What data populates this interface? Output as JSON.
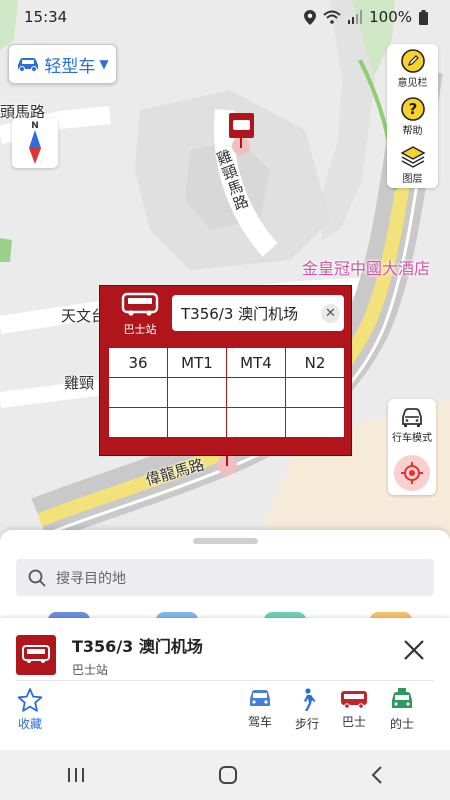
{
  "status": {
    "time": "15:34",
    "battery": "100%"
  },
  "vehicle": {
    "label": "轻型车"
  },
  "compass": {
    "north": "N"
  },
  "map_labels": {
    "road_1": "頭馬路",
    "road_2": "雞頸馬路",
    "road_3": "天文台",
    "road_4": "雞頸",
    "road_5": "偉龍馬路",
    "hotel": "金皇冠中國大酒店"
  },
  "tools": [
    {
      "label": "意见栏",
      "icon": "feedback-icon"
    },
    {
      "label": "帮助",
      "icon": "help-icon"
    },
    {
      "label": "图层",
      "icon": "layers-icon"
    }
  ],
  "drive_mode": {
    "label": "行车模式"
  },
  "popup": {
    "type_label": "巴士站",
    "stop_name": "T356/3 澳门机场",
    "routes": [
      "36",
      "MT1",
      "MT4",
      "N2",
      "",
      "",
      "",
      "",
      "",
      "",
      "",
      ""
    ]
  },
  "search": {
    "placeholder": "搜寻目的地"
  },
  "detail": {
    "title": "T356/3 澳门机场",
    "subtitle": "巴士站",
    "favorite_label": "收藏",
    "actions": [
      {
        "label": "驾车",
        "icon": "car-icon"
      },
      {
        "label": "步行",
        "icon": "walk-icon"
      },
      {
        "label": "巴士",
        "icon": "bus-icon"
      },
      {
        "label": "的士",
        "icon": "taxi-icon"
      }
    ]
  },
  "colors": {
    "accent": "#2a6fdb",
    "bus_red": "#b0151c",
    "road_yellow": "#f3e27a"
  }
}
